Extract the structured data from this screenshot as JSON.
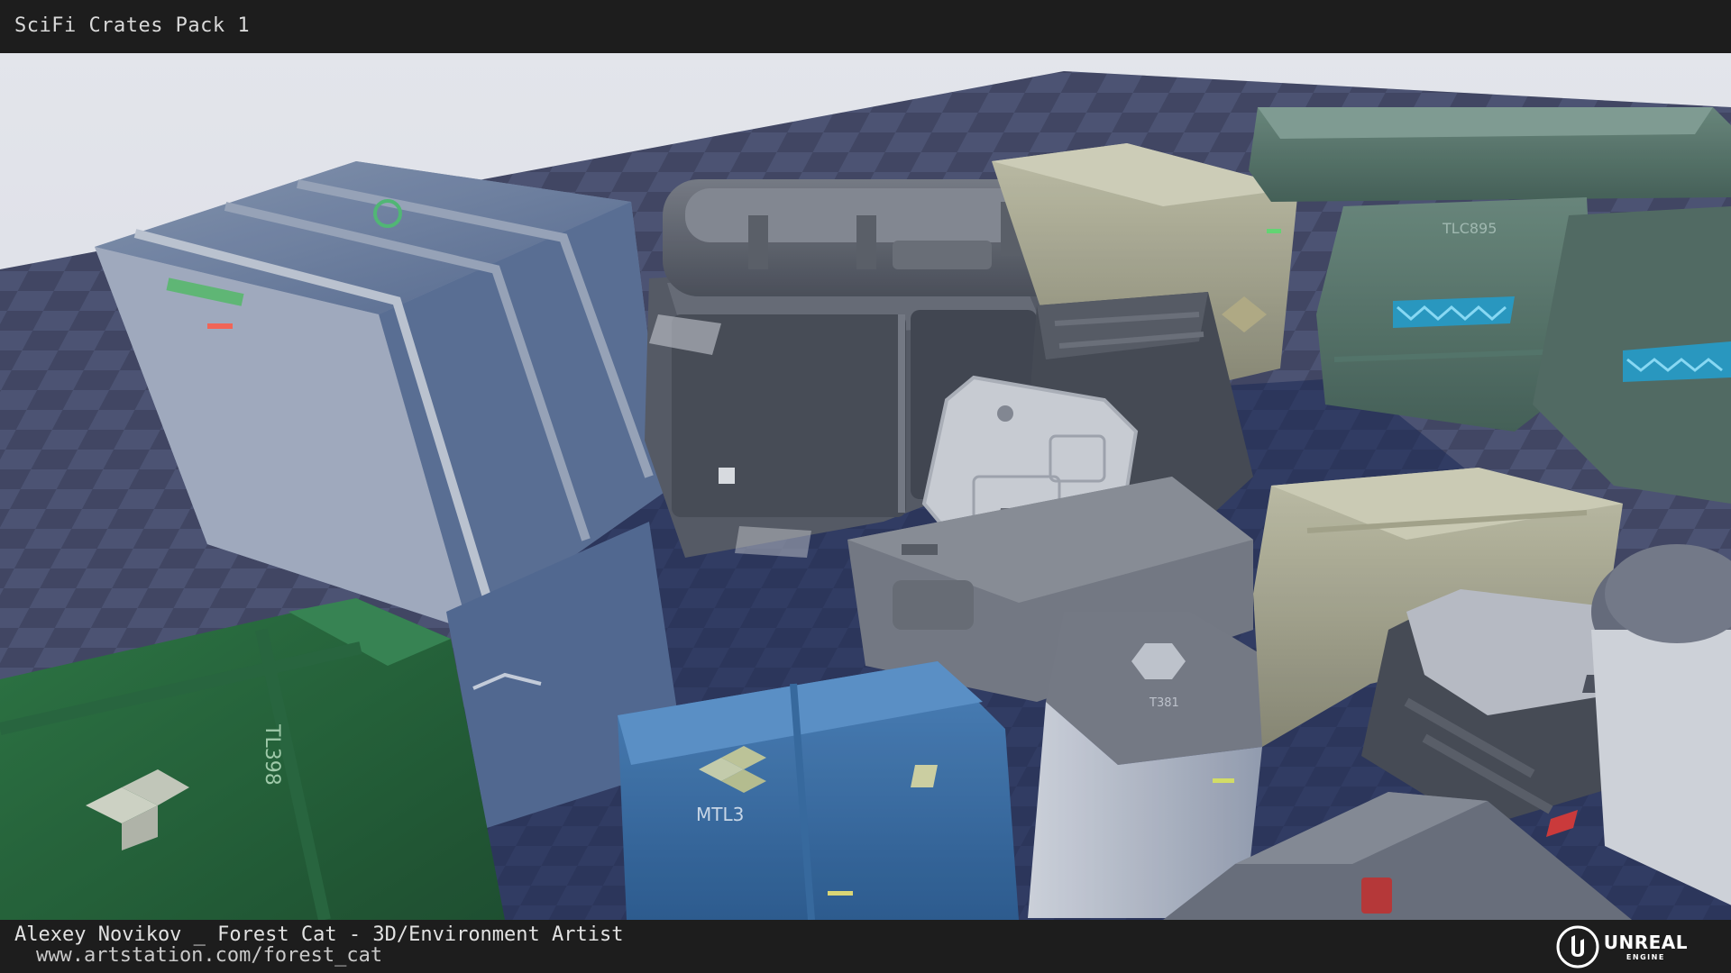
{
  "header": {
    "title": "SciFi Crates Pack 1"
  },
  "viewport": {
    "crate_labels": {
      "green_crate": "TL398",
      "blue_crate": "MTL3",
      "teal_crate": "TLC895",
      "white_canister": "T381"
    }
  },
  "footer": {
    "credit": "Alexey Novikov _ Forest Cat - 3D/Environment Artist",
    "url": "www.artstation.com/forest_cat",
    "logo_word": "UNREAL",
    "logo_sub": "ENGINE"
  },
  "colors": {
    "bar": "#1d1d1d",
    "sky": "#e9ecf3",
    "floor_dark": "#4a4f66",
    "floor_light": "#5f6580"
  }
}
